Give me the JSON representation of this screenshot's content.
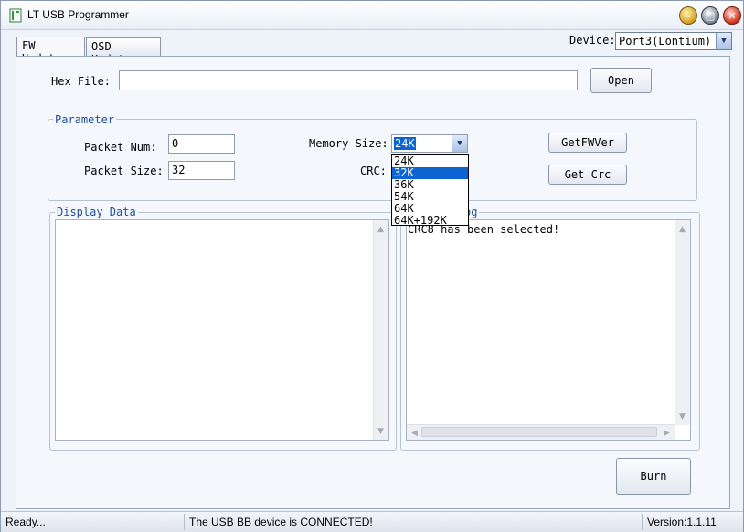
{
  "window": {
    "title": "LT USB Programmer"
  },
  "tabs": [
    {
      "label": "FW Update"
    },
    {
      "label": "OSD Update"
    }
  ],
  "device": {
    "label": "Device:",
    "value": "Port3(Lontium)"
  },
  "hex_file": {
    "label": "Hex File:",
    "value": "",
    "open_label": "Open"
  },
  "parameter": {
    "title": "Parameter",
    "packet_num_label": "Packet Num:",
    "packet_num_value": "0",
    "packet_size_label": "Packet Size:",
    "packet_size_value": "32",
    "memory_size_label": "Memory Size:",
    "memory_size_value": "24K",
    "memory_options": [
      "24K",
      "32K",
      "36K",
      "54K",
      "64K",
      "64K+192K"
    ],
    "memory_highlighted": "32K",
    "crc_label": "CRC:",
    "getfwver_label": "GetFWVer",
    "getcrc_label": "Get Crc"
  },
  "display_data": {
    "title": "Display Data",
    "content": ""
  },
  "log": {
    "title": "og",
    "content": "CRC8 has been selected!"
  },
  "burn_label": "Burn",
  "status": {
    "ready": "Ready...",
    "connection": "The USB BB device is CONNECTED!",
    "version": "Version:1.1.11"
  },
  "colors": {
    "group_title": "#1f4f9c",
    "highlight": "#0a64d2"
  }
}
